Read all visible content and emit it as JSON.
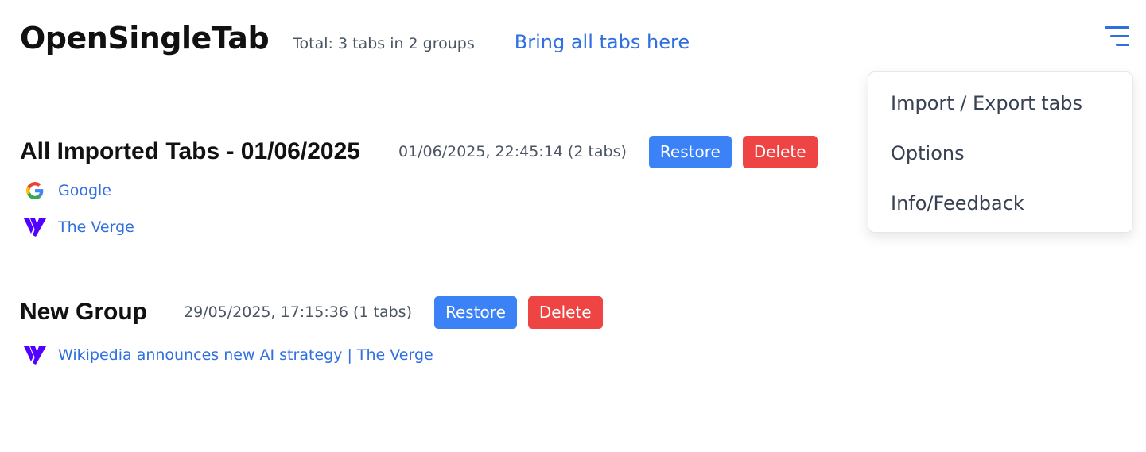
{
  "header": {
    "app_title": "OpenSingleTab",
    "total": "Total: 3 tabs in 2 groups",
    "bring_all": "Bring all tabs here"
  },
  "menu": {
    "icon": "hamburger-menu-icon",
    "items": [
      {
        "label": "Import / Export tabs"
      },
      {
        "label": "Options"
      },
      {
        "label": "Info/Feedback"
      }
    ]
  },
  "groups": [
    {
      "title": "All Imported Tabs - 01/06/2025",
      "meta": "01/06/2025, 22:45:14 (2 tabs)",
      "restore_label": "Restore",
      "delete_label": "Delete",
      "tabs": [
        {
          "title": "Google",
          "icon": "google-icon"
        },
        {
          "title": "The Verge",
          "icon": "verge-icon"
        }
      ]
    },
    {
      "title": "New Group",
      "meta": "29/05/2025, 17:15:36 (1 tabs)",
      "restore_label": "Restore",
      "delete_label": "Delete",
      "tabs": [
        {
          "title": "Wikipedia announces new AI strategy | The Verge",
          "icon": "verge-icon"
        }
      ]
    }
  ],
  "colors": {
    "link": "#2f6fe0",
    "restore": "#3b82f6",
    "delete": "#ef4444",
    "verge": "#5200ff"
  }
}
